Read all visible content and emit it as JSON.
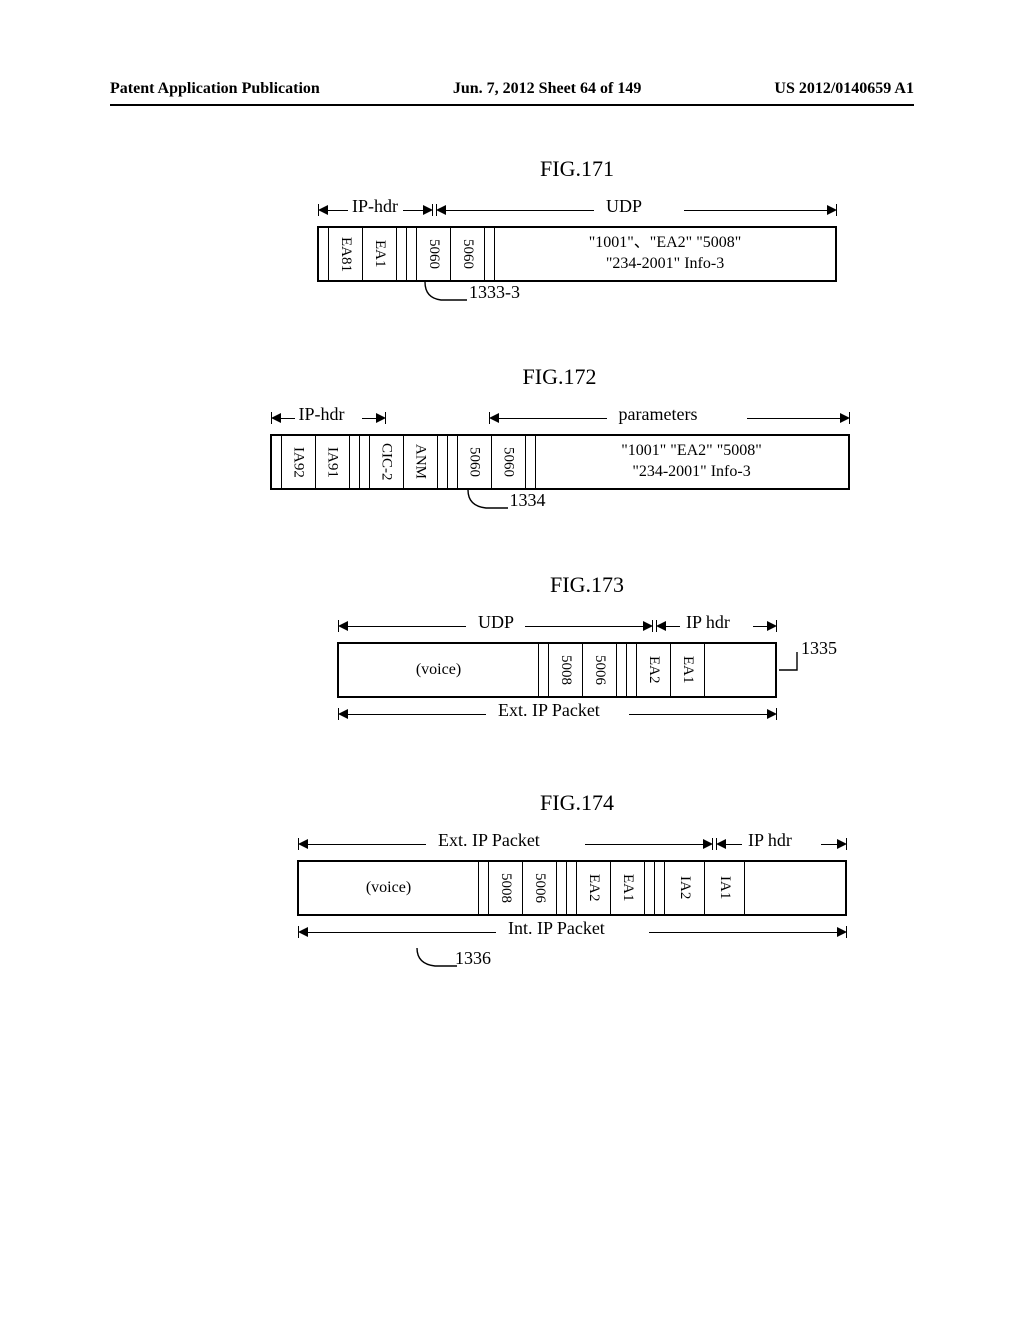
{
  "header": {
    "left": "Patent Application Publication",
    "center": "Jun. 7, 2012  Sheet 64 of 149",
    "right": "US 2012/0140659 A1"
  },
  "fig171": {
    "title": "FIG.171",
    "range_iphdr": "IP-hdr",
    "range_udp": "UDP",
    "c_ea81": "EA81",
    "c_ea1": "EA1",
    "c_5060a": "5060",
    "c_5060b": "5060",
    "payload_top": "\"1001\"、\"EA2\"  \"5008\"",
    "payload_bot": "\"234-2001\"   Info-3",
    "ref": "1333-3"
  },
  "fig172": {
    "title": "FIG.172",
    "range_iphdr": "IP-hdr",
    "range_params": "parameters",
    "c_ia92": "IA92",
    "c_ia91": "IA91",
    "c_cic2": "CIC-2",
    "c_anm": "ANM",
    "c_5060a": "5060",
    "c_5060b": "5060",
    "payload_top": "\"1001\"  \"EA2\"  \"5008\"",
    "payload_bot": "\"234-2001\"    Info-3",
    "ref": "1334"
  },
  "fig173": {
    "title": "FIG.173",
    "range_udp": "UDP",
    "range_iphdr": "IP hdr",
    "c_voice": "(voice)",
    "c_5008": "5008",
    "c_5006": "5006",
    "c_ea2": "EA2",
    "c_ea1": "EA1",
    "range_extip": "Ext. IP Packet",
    "ref": "1335"
  },
  "fig174": {
    "title": "FIG.174",
    "range_extip": "Ext. IP Packet",
    "range_iphdr": "IP hdr",
    "c_voice": "(voice)",
    "c_5008": "5008",
    "c_5006": "5006",
    "c_ea2": "EA2",
    "c_ea1": "EA1",
    "c_ia2": "IA2",
    "c_ia1": "IA1",
    "range_intip": "Int. IP Packet",
    "ref": "1336"
  }
}
